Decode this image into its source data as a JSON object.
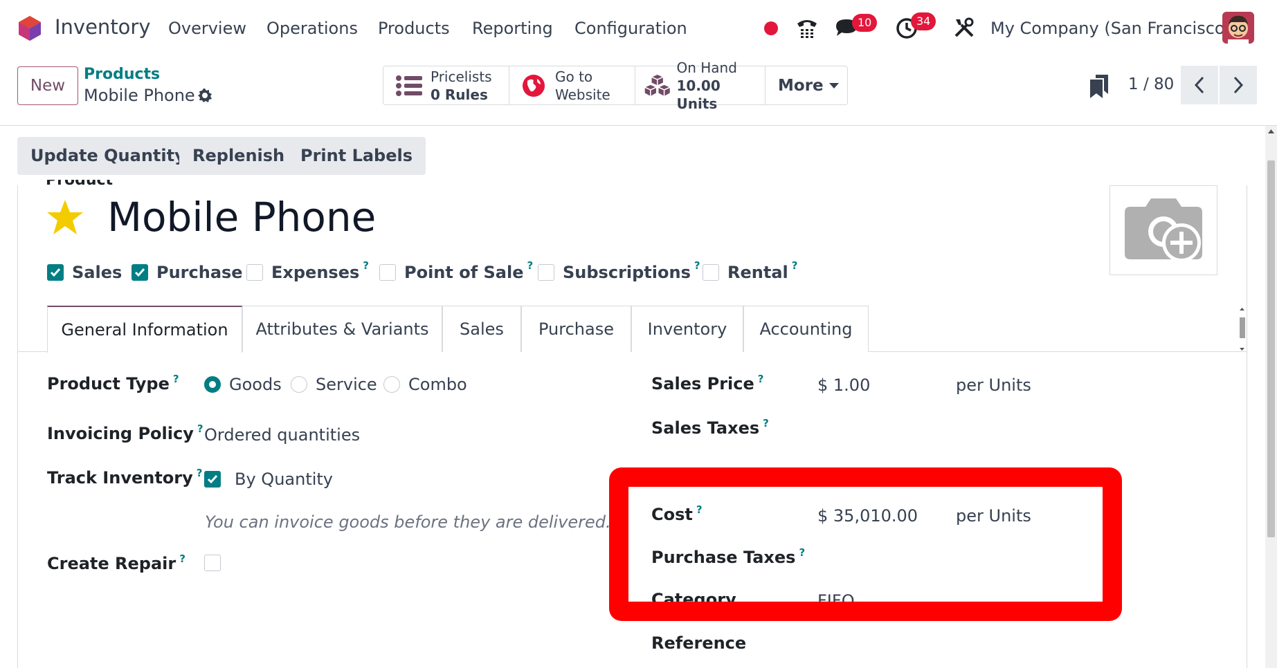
{
  "app": {
    "name": "Inventory"
  },
  "menu": [
    "Overview",
    "Operations",
    "Products",
    "Reporting",
    "Configuration"
  ],
  "systray": {
    "messages_count": "10",
    "activities_count": "34",
    "company": "My Company (San Francisco)"
  },
  "control": {
    "new_label": "New",
    "breadcrumb_parent": "Products",
    "breadcrumb_current": "Mobile Phone",
    "smart_buttons": {
      "pricelists_label": "Pricelists",
      "pricelists_value": "0",
      "pricelists_unit": "Rules",
      "website_line1": "Go to",
      "website_line2": "Website",
      "onhand_label": "On Hand",
      "onhand_value": "10.00",
      "onhand_unit": "Units",
      "more_label": "More"
    },
    "pager": "1 / 80"
  },
  "actions": {
    "update_qty": "Update Quantity",
    "replenish": "Replenish",
    "print_labels": "Print Labels"
  },
  "product": {
    "cut_label": "Product",
    "name": "Mobile Phone",
    "favorite": true,
    "options": [
      {
        "label": "Sales",
        "checked": true,
        "help": ""
      },
      {
        "label": "Purchase",
        "checked": true,
        "help": ""
      },
      {
        "label": "Expenses",
        "checked": false,
        "help": "?"
      },
      {
        "label": "Point of Sale",
        "checked": false,
        "help": "?"
      },
      {
        "label": "Subscriptions",
        "checked": false,
        "help": "?"
      },
      {
        "label": "Rental",
        "checked": false,
        "help": "?"
      }
    ]
  },
  "tabs": [
    "General Information",
    "Attributes & Variants",
    "Sales",
    "Purchase",
    "Inventory",
    "Accounting"
  ],
  "general": {
    "product_type_label": "Product Type",
    "product_type_options": [
      "Goods",
      "Service",
      "Combo"
    ],
    "product_type_selected": "Goods",
    "invoicing_policy_label": "Invoicing Policy",
    "invoicing_policy_value": "Ordered quantities",
    "track_inventory_label": "Track Inventory",
    "track_inventory_value": "By Quantity",
    "track_hint": "You can invoice goods before they are delivered.",
    "create_repair_label": "Create Repair",
    "sales_price_label": "Sales Price",
    "sales_price_value": "$ 1.00",
    "sales_price_unit": "per Units",
    "sales_taxes_label": "Sales Taxes",
    "cost_label": "Cost",
    "cost_value": "$ 35,010.00",
    "cost_unit": "per Units",
    "purchase_taxes_label": "Purchase Taxes",
    "category_label": "Category",
    "category_value": "FIFO",
    "reference_label": "Reference",
    "help_mark": "?"
  },
  "colors": {
    "accent": "#017e84",
    "brand": "#714b67",
    "badge": "#e3173b",
    "highlight": "#ff0000"
  }
}
